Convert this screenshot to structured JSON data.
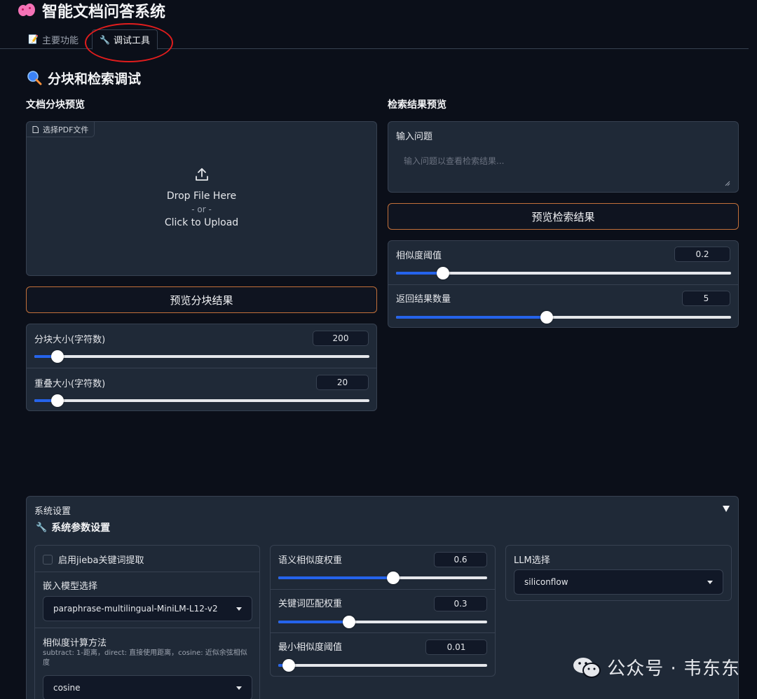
{
  "app": {
    "title": "智能文档问答系统",
    "title_icon": "brain-icon"
  },
  "tabs": [
    {
      "label": "主要功能",
      "icon": "memo-icon"
    },
    {
      "label": "调试工具",
      "icon": "wrench-icon"
    }
  ],
  "debug": {
    "section_title": "分块和检索调试",
    "section_icon": "magnifier-icon",
    "chunk_preview": {
      "title": "文档分块预览",
      "upload_label": "选择PDF文件",
      "drop_text": "Drop File Here",
      "or_text": "- or -",
      "click_text": "Click to Upload",
      "button": "预览分块结果",
      "chunk_size": {
        "label": "分块大小(字符数)",
        "value": "200",
        "fraction": 0.07
      },
      "overlap_size": {
        "label": "重叠大小(字符数)",
        "value": "20",
        "fraction": 0.07
      }
    },
    "retrieval_preview": {
      "title": "检索结果预览",
      "question_label": "输入问题",
      "question_placeholder": "输入问题以查看检索结果...",
      "button": "预览检索结果",
      "threshold": {
        "label": "相似度阈值",
        "value": "0.2",
        "fraction": 0.14
      },
      "top_k": {
        "label": "返回结果数量",
        "value": "5",
        "fraction": 0.45
      }
    }
  },
  "settings": {
    "accordion_label": "系统设置",
    "collapse_icon": "triangle-down-icon",
    "title": "系统参数设置",
    "title_icon": "wrench-icon",
    "jieba_label": "启用jieba关键词提取",
    "jieba_checked": false,
    "embed_label": "嵌入模型选择",
    "embed_value": "paraphrase-multilingual-MiniLM-L12-v2",
    "sim_method_label": "相似度计算方法",
    "sim_method_info": "subtract: 1-距离，direct: 直接使用距离，cosine: 近似余弦相似度",
    "sim_method_value": "cosine",
    "semantic_weight": {
      "label": "语义相似度权重",
      "value": "0.6",
      "fraction": 0.55
    },
    "keyword_weight": {
      "label": "关键词匹配权重",
      "value": "0.3",
      "fraction": 0.34
    },
    "min_threshold": {
      "label": "最小相似度阈值",
      "value": "0.01",
      "fraction": 0.05
    },
    "llm_label": "LLM选择",
    "llm_value": "siliconflow"
  },
  "watermark": {
    "text": "公众号 · 韦东东",
    "icon": "wechat-icon"
  },
  "colors": {
    "accent": "#2563eb",
    "button_border": "#c2703a",
    "background": "#0b0f19",
    "panel": "#1f2937",
    "highlight_circle": "#e11d1d"
  }
}
